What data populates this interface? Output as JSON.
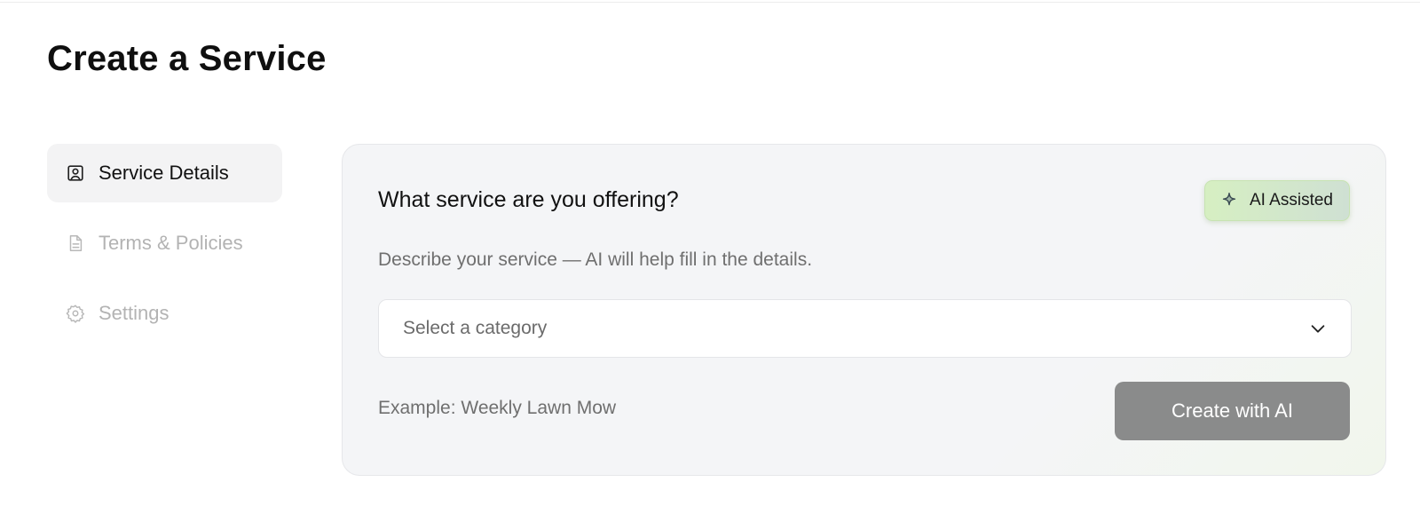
{
  "page": {
    "title": "Create a Service"
  },
  "sidebar": {
    "items": [
      {
        "label": "Service Details",
        "icon": "user-square-icon",
        "active": true
      },
      {
        "label": "Terms & Policies",
        "icon": "document-icon",
        "active": false
      },
      {
        "label": "Settings",
        "icon": "gear-icon",
        "active": false
      }
    ]
  },
  "card": {
    "heading": "What service are you offering?",
    "badge": {
      "label": "AI Assisted",
      "icon": "sparkle-icon"
    },
    "description": "Describe your service — AI will help fill in the details.",
    "category_select": {
      "placeholder": "Select a category",
      "icon": "chevron-down-icon"
    },
    "example_text": "Example: Weekly Lawn Mow",
    "create_button_label": "Create with AI"
  },
  "colors": {
    "badge_bg": "#d6efc2",
    "button_bg": "#8a8b8b",
    "card_bg": "#f4f5f7",
    "inactive_text": "#b3b3b3"
  }
}
